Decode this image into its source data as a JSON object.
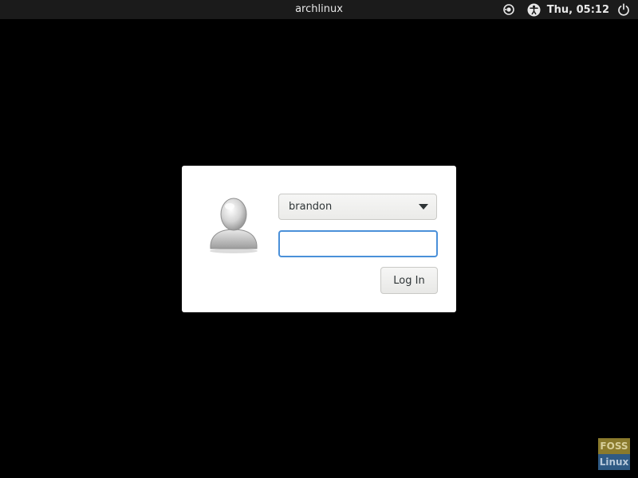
{
  "topbar": {
    "hostname": "archlinux",
    "clock": "Thu, 05:12",
    "icons": [
      "network-icon",
      "accessibility-icon",
      "power-icon"
    ]
  },
  "login": {
    "selected_user": "brandon",
    "password_value": "",
    "login_button_label": "Log In",
    "avatar_icon": "user-avatar-icon",
    "focus_color": "#4a90d9"
  },
  "watermark": {
    "line1": "FOSS",
    "line2": "Linux"
  }
}
